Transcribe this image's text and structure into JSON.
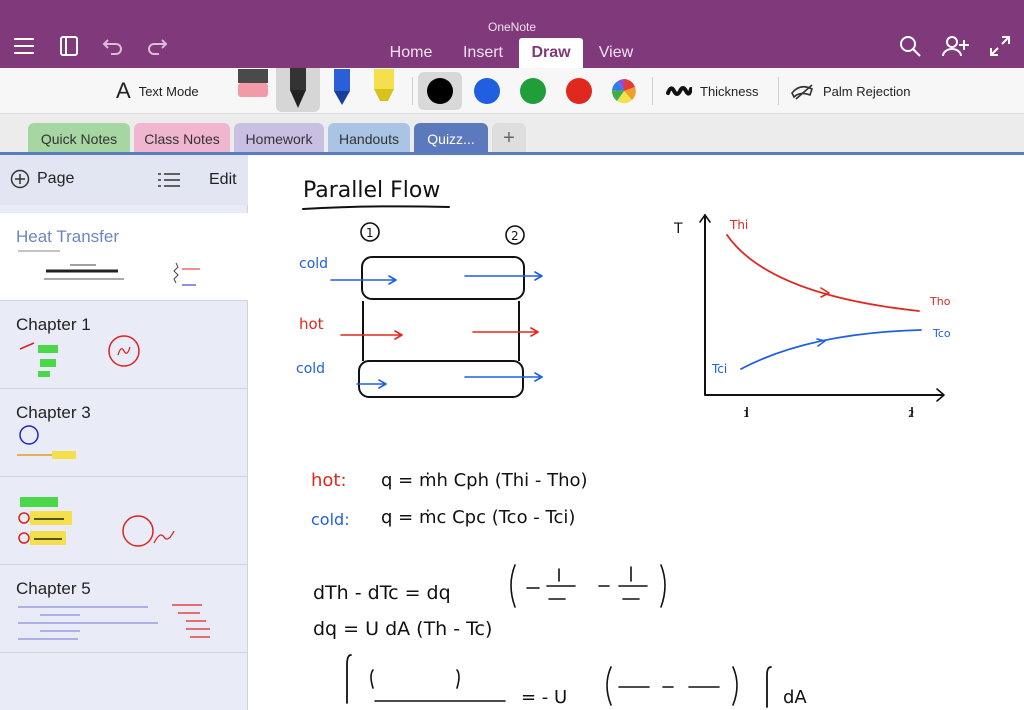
{
  "app": {
    "title": "OneNote"
  },
  "ribbon": {
    "tabs": [
      {
        "label": "Home",
        "active": false
      },
      {
        "label": "Insert",
        "active": false
      },
      {
        "label": "Draw",
        "active": true
      },
      {
        "label": "View",
        "active": false
      }
    ]
  },
  "toolbar": {
    "text_mode_label": "Text Mode",
    "thickness_label": "Thickness",
    "palm_rejection_label": "Palm Rejection",
    "colors": [
      "#000000",
      "#1f5fe0",
      "#1f9e3a",
      "#e0281e"
    ]
  },
  "sections": [
    {
      "label": "Quick Notes",
      "color": "#a6d7a2"
    },
    {
      "label": "Class Notes",
      "color": "#f0b6cf"
    },
    {
      "label": "Homework",
      "color": "#c8c0e2"
    },
    {
      "label": "Handouts",
      "color": "#a9c4e4"
    },
    {
      "label": "Quizz...",
      "color": "#5d79bd",
      "active": true
    }
  ],
  "page_pane": {
    "add_page_label": "Page",
    "edit_label": "Edit",
    "pages": [
      {
        "title": "Heat Transfer",
        "selected": true
      },
      {
        "title": "Chapter 1",
        "selected": false
      },
      {
        "title": "Chapter 3",
        "selected": false
      },
      {
        "title": "",
        "selected": false
      },
      {
        "title": "Chapter 5",
        "selected": false
      }
    ]
  },
  "note": {
    "heading": "Parallel Flow",
    "marker_1": "1",
    "marker_2": "2",
    "cold_label_1": "cold",
    "hot_label": "hot",
    "cold_label_2": "cold",
    "graph": {
      "y_axis": "T",
      "t_hi": "Thi",
      "t_ho": "Tho",
      "t_co": "Tco",
      "t_ci": "Tci",
      "tick_1": "1",
      "tick_2": "2"
    },
    "eq_hot_label": "hot:",
    "eq_hot": "q = ṁh Cph (Thi - Tho)",
    "eq_cold_label": "cold:",
    "eq_cold": "q = ṁc Cpc (Tco - Tci)",
    "eq_dt": "dTh - dTc = dq",
    "eq_dq": "dq = U dA (Th - Tc)",
    "eq_int": "= - U",
    "eq_da": "dA"
  }
}
